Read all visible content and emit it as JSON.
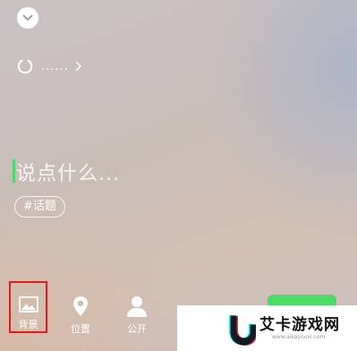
{
  "header": {
    "collapse_icon": "chevron-down-icon"
  },
  "status": {
    "icon": "loading-spinner-icon",
    "text": "......"
  },
  "composer": {
    "placeholder": "说点什么...",
    "topic_tag": "#话题"
  },
  "toolbar": {
    "items": [
      {
        "icon": "image-icon",
        "label": "背景",
        "highlighted": true
      },
      {
        "icon": "location-pin-icon",
        "label": "位置"
      },
      {
        "icon": "person-icon",
        "label": "公开"
      }
    ],
    "highlight_color": "#e21b1b",
    "publish_color": "#4cd964"
  },
  "watermark": {
    "title": "艾卡游戏网",
    "url": "www.aikayouxi.com"
  }
}
